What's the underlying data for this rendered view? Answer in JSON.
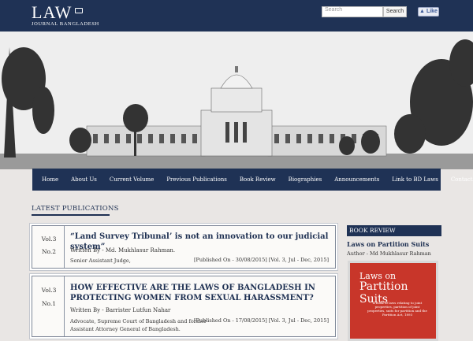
{
  "header": {
    "logo_main": "LAW",
    "logo_sub": "JOURNAL BANGLADESH",
    "search_placeholder": "Search",
    "search_button": "Search",
    "like_button": "Like"
  },
  "nav": [
    "Home",
    "About Us",
    "Current Volume",
    "Previous Publications",
    "Book Review",
    "Biographies",
    "Announcements",
    "Link to BD Laws",
    "Contact"
  ],
  "latest": {
    "heading": "LATEST PUBLICATIONS",
    "items": [
      {
        "vol": "Vol.3",
        "no": "No.2",
        "title": "“Land Survey Tribunal’ is not an innovation to our judicial system”",
        "author": "Written By - Md. Mukhlasur Rahman.",
        "role": "Senior Assistant Judge,",
        "meta": "[Published On - 30/08/2015] [Vol. 3, Jul - Dec, 2015]"
      },
      {
        "vol": "Vol.3",
        "no": "No.1",
        "title": "HOW EFFECTIVE ARE THE LAWS OF BANGLADESH IN PROTECTING WOMEN FROM SEXUAL HARASSMENT?",
        "author": "Written By - Barrister Lutfun Nahar",
        "role": "Advocate, Supreme Court of Bangladesh and former Assistant Attorney General of Bangladesh.",
        "meta": "[Published On - 17/08/2015] [Vol. 3, Jul - Dec, 2015]"
      }
    ]
  },
  "book_review": {
    "heading": "BOOK REVIEW",
    "title": "Laws on Partition Suits",
    "author": "Author - Md Mukhlasur Rahman",
    "cover_line1": "Laws on",
    "cover_line2": "Partition Suits",
    "cover_desc": "A book of laws relating to joint properties, partition of joint properties, suits for partition and the Partition Act, 1893"
  },
  "colors": {
    "navy": "#1f3255",
    "book_red": "#c8362a"
  }
}
